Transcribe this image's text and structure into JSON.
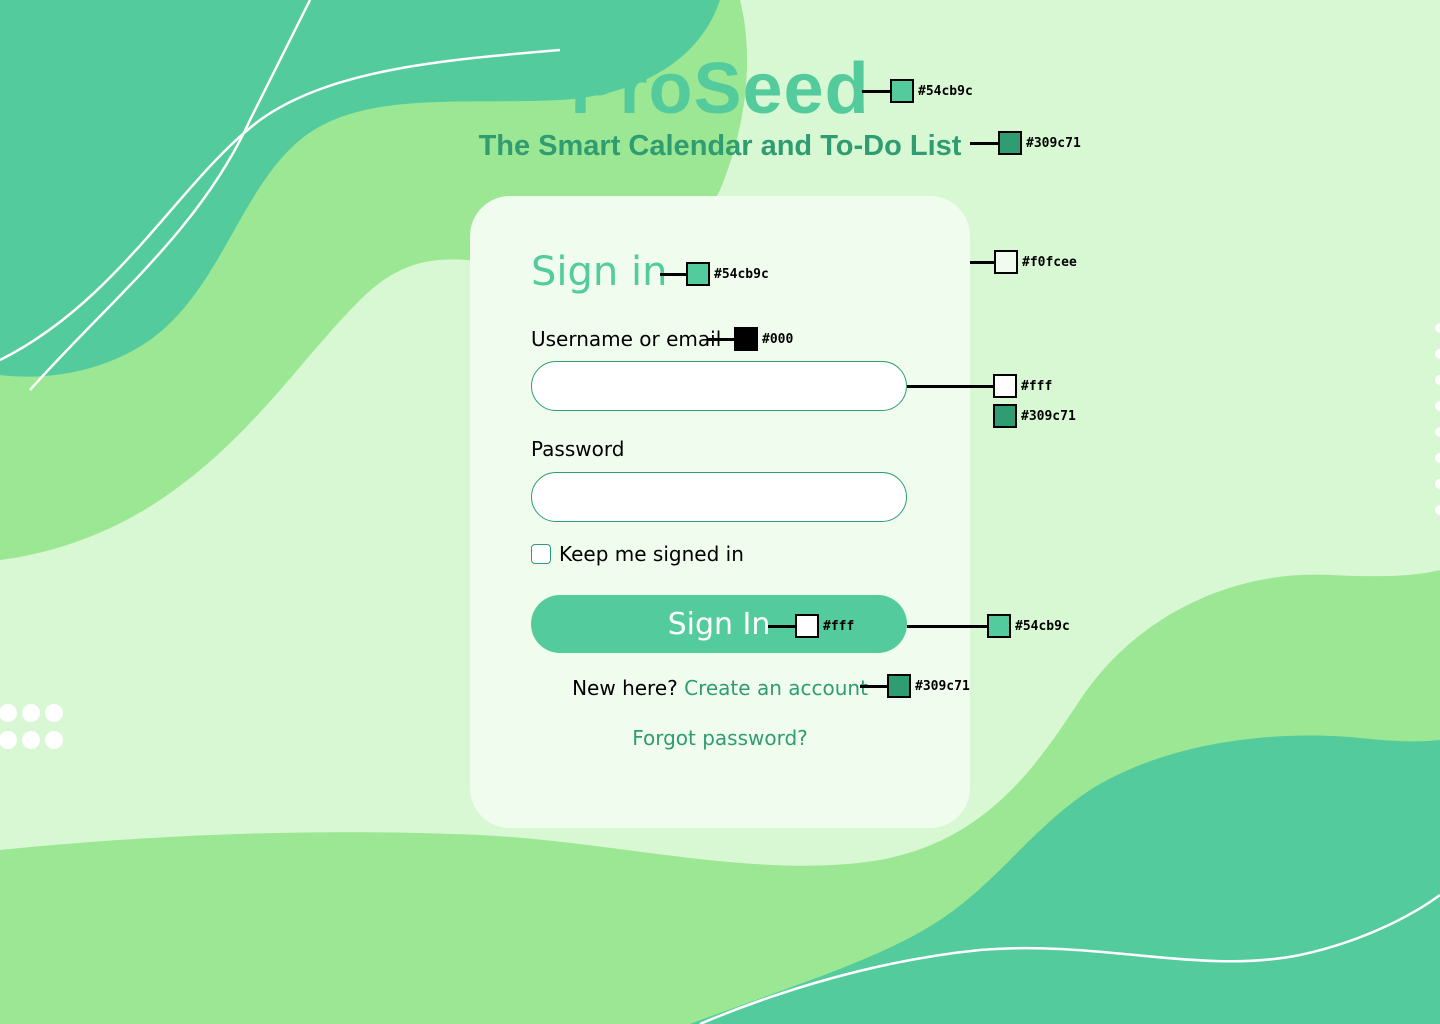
{
  "app": {
    "logo": "ProSeed",
    "tagline": "The Smart Calendar and To-Do List"
  },
  "form": {
    "title": "Sign in",
    "username_label": "Username or email",
    "username_value": "",
    "password_label": "Password",
    "password_value": "",
    "keep_signed_in_label": "Keep me signed in",
    "keep_signed_in_checked": false,
    "submit_label": "Sign In",
    "new_here_text": "New here?",
    "create_account_link": "Create an account",
    "forgot_password_link": "Forgot password?"
  },
  "colors": {
    "primary": "#54cb9c",
    "dark": "#309c71",
    "card": "#f0fcee",
    "text": "#000",
    "white": "#fff"
  },
  "swatches": {
    "logo": "#54cb9c",
    "tagline": "#309c71",
    "title": "#54cb9c",
    "card": "#f0fcee",
    "label": "#000",
    "input_bg": "#fff",
    "input_border": "#309c71",
    "button_text": "#fff",
    "button_bg": "#54cb9c",
    "link": "#309c71"
  },
  "icons": [
    "freepik-watermark"
  ]
}
